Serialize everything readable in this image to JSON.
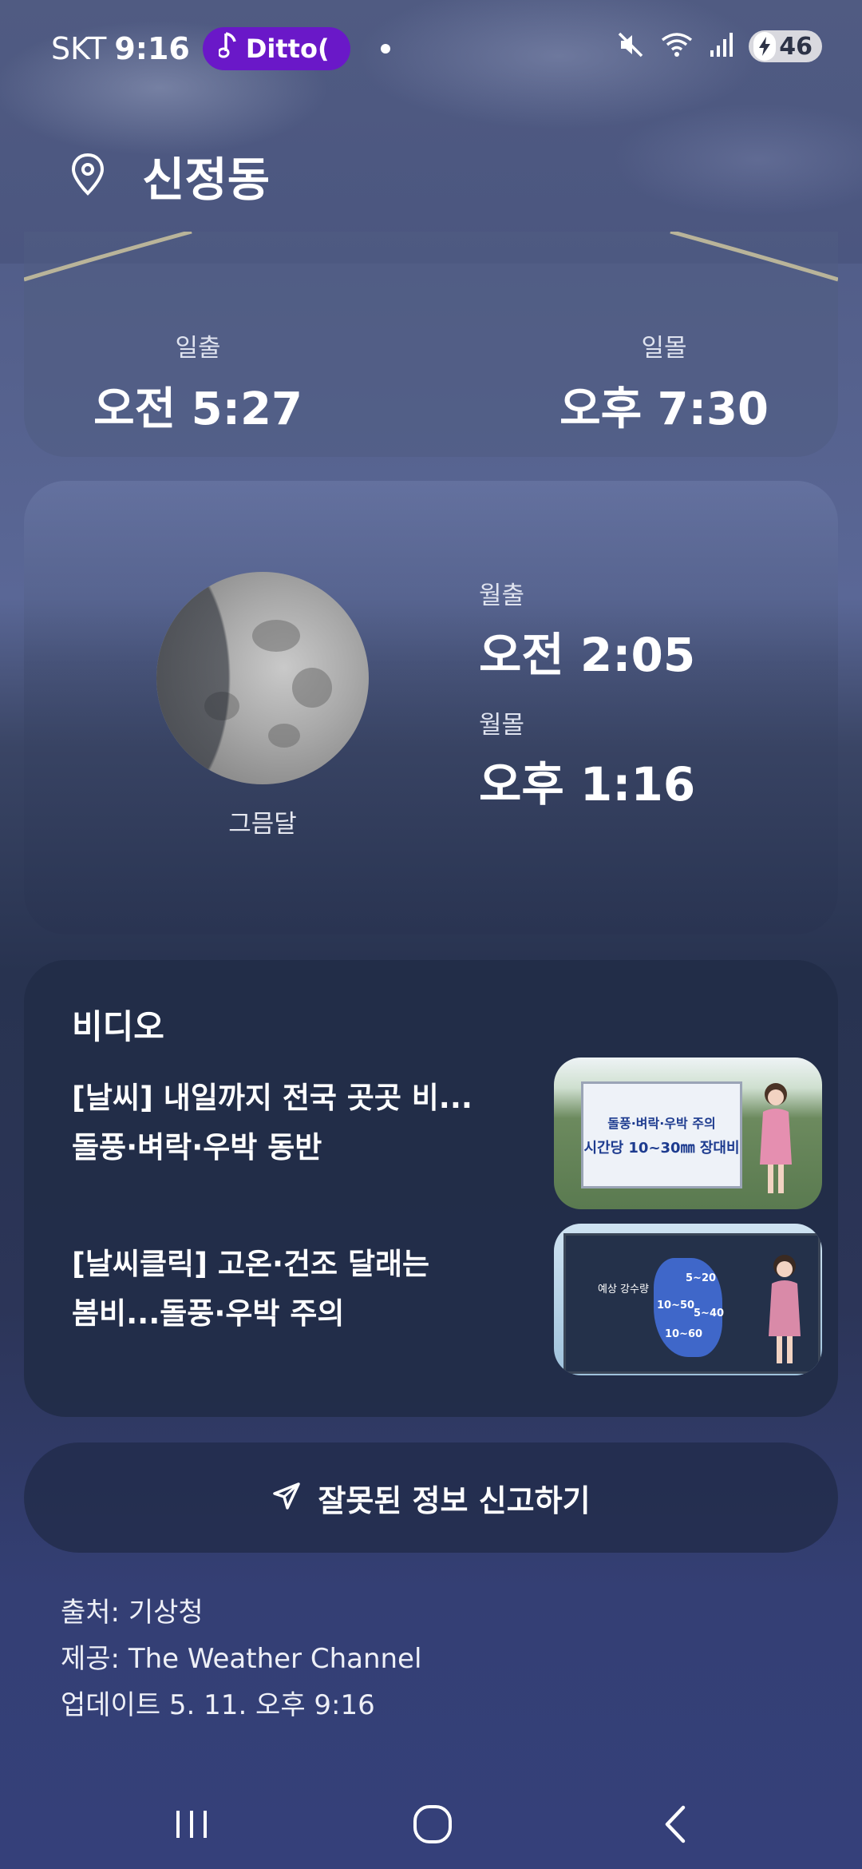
{
  "status_bar": {
    "carrier": "SKT",
    "time": "9:16",
    "media_pill": "Ditto(",
    "battery": "46"
  },
  "header": {
    "location": "신정동"
  },
  "sun": {
    "sunrise_label": "일출",
    "sunrise_time": "오전 5:27",
    "sunset_label": "일몰",
    "sunset_time": "오후 7:30"
  },
  "moon": {
    "phase": "그믐달",
    "moonrise_label": "월출",
    "moonrise_time": "오전 2:05",
    "moonset_label": "월몰",
    "moonset_time": "오후 1:16"
  },
  "video": {
    "title": "비디오",
    "items": [
      {
        "line1": "[날씨] 내일까지 전국 곳곳 비...",
        "line2": "돌풍·벼락·우박 동반",
        "thumb_line1": "돌풍·벼락·우박 주의",
        "thumb_line2": "시간당 10~30㎜ 장대비"
      },
      {
        "line1": "[날씨클릭] 고온·건조 달래는",
        "line2": "봄비...돌풍·우박 주의",
        "thumb_label": "예상 강수량",
        "thumb_values": [
          "5~20",
          "10~50",
          "5~40",
          "10~60"
        ]
      }
    ]
  },
  "report": {
    "label": "잘못된 정보 신고하기"
  },
  "footer": {
    "source": "출처: 기상청",
    "provider": "제공: The Weather Channel",
    "updated": "업데이트 5. 11. 오후 9:16"
  },
  "colors": {
    "accent_pill": "#6a18c8",
    "card_dark": "#222c48"
  }
}
